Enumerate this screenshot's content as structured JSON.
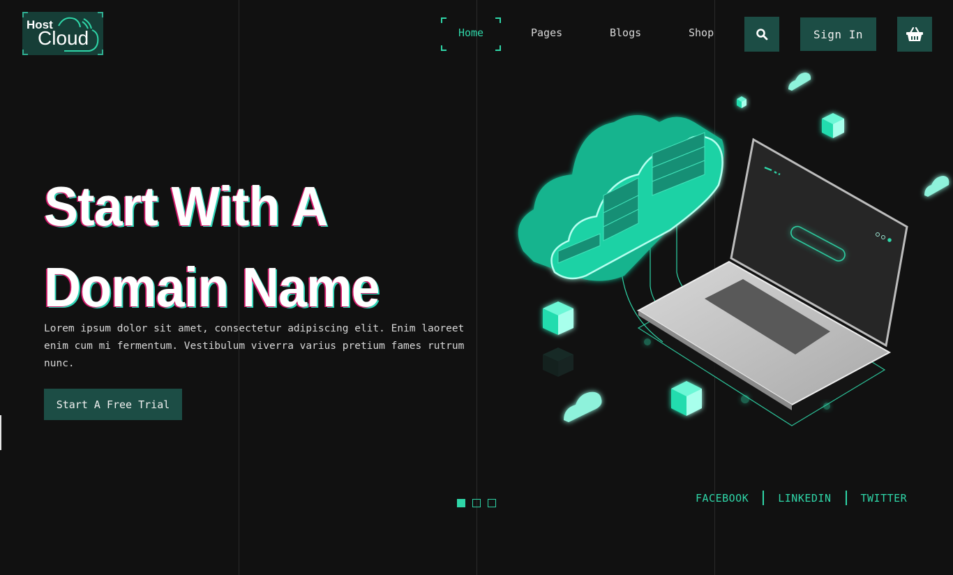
{
  "brand": {
    "logo_line1": "Host",
    "logo_line2": "Cloud",
    "accent_color": "#2fd6a8",
    "button_color": "#1c4d45",
    "background_color": "#111111"
  },
  "nav": {
    "items": [
      {
        "label": "Home",
        "active": true
      },
      {
        "label": "Pages",
        "active": false
      },
      {
        "label": "Blogs",
        "active": false
      },
      {
        "label": "Shop",
        "active": false
      }
    ],
    "search_icon": "search-icon",
    "signin_label": "Sign In",
    "cart_icon": "shopping-basket-icon"
  },
  "hero": {
    "title_line1": "Start With A",
    "title_line2": "Domain Name",
    "description": "Lorem ipsum dolor sit amet, consectetur adipiscing elit. Enim laoreet enim cum mi fermentum. Vestibulum viverra varius pretium fames rutrum nunc.",
    "cta_label": "Start A Free Trial"
  },
  "slider": {
    "total": 3,
    "active_index": 0
  },
  "social": {
    "links": [
      "FACEBOOK",
      "LINKEDIN",
      "TWITTER"
    ]
  },
  "illustration": {
    "subject": "isometric cloud server and laptop"
  }
}
